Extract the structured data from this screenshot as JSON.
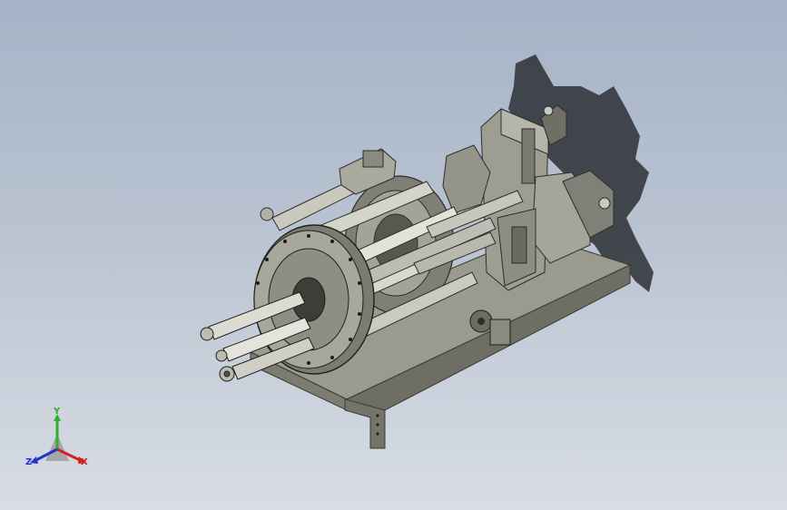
{
  "viewport": {
    "background_top": "#a6b3c7",
    "background_bottom": "#d8dde5",
    "model_color": "#8f8f84",
    "shadow_color": "#2d2f35"
  },
  "triad": {
    "x_label": "X",
    "y_label": "Y",
    "z_label": "Z",
    "x_color": "#d42020",
    "y_color": "#2fae2f",
    "z_color": "#2233cc"
  }
}
